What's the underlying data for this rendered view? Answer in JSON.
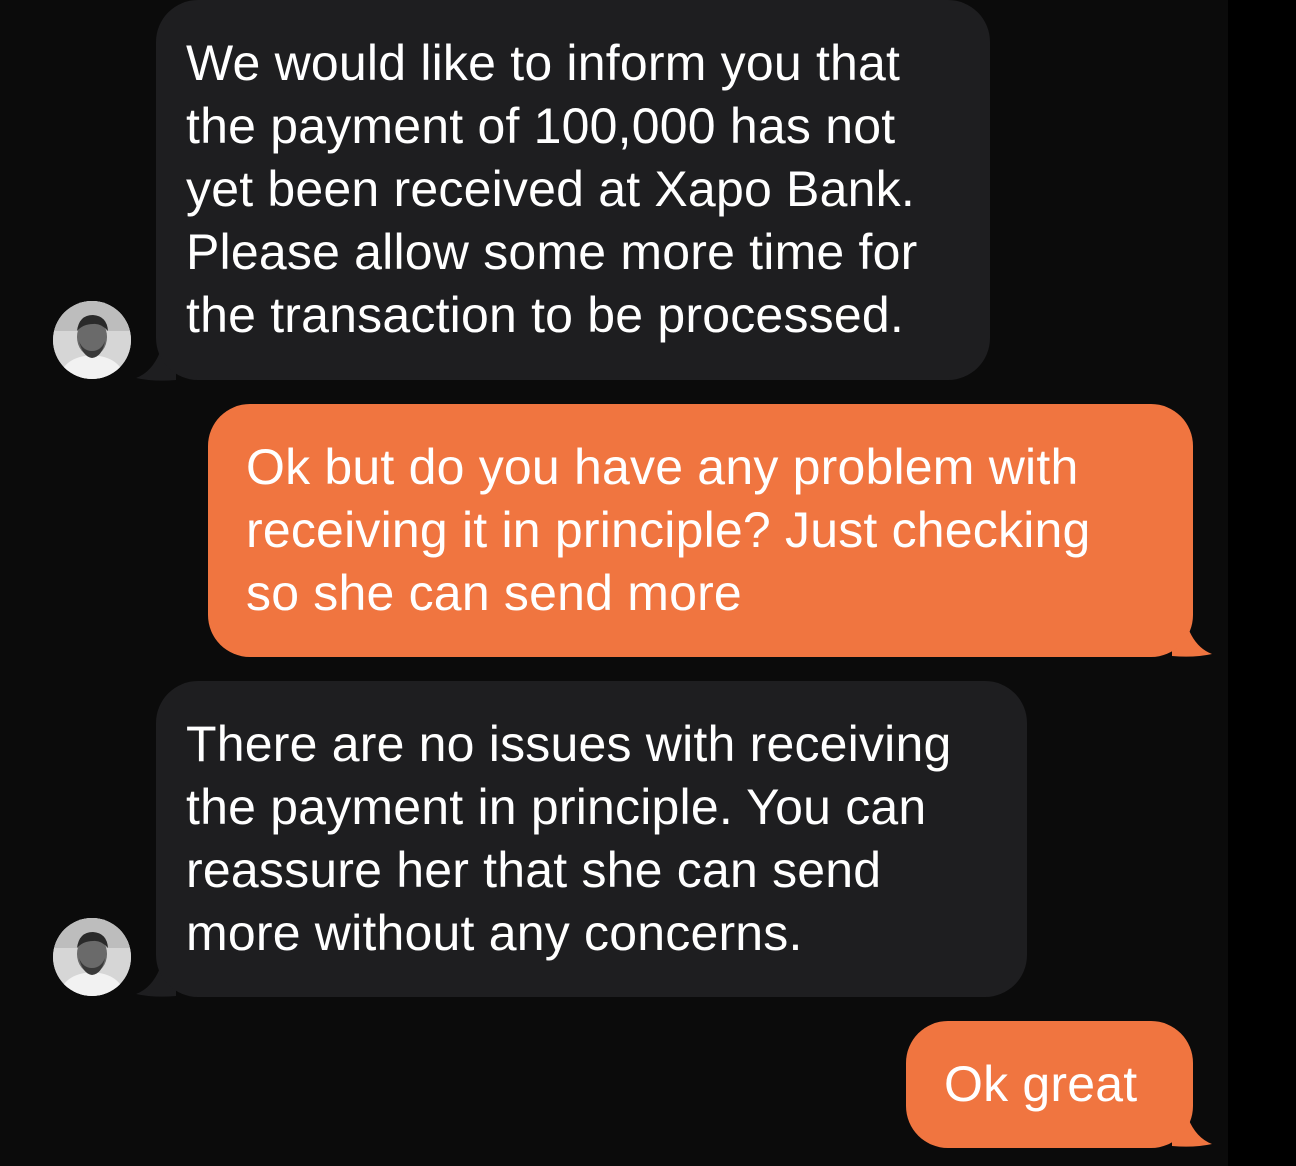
{
  "conversation": {
    "messages": [
      {
        "sender": "contact",
        "lines": [
          "We would like to inform you that",
          "the payment of 100,000 has not",
          "yet been received at Xapo Bank.",
          "Please allow some more time for",
          "the transaction to be processed."
        ]
      },
      {
        "sender": "me",
        "lines": [
          "Ok but do you have any problem with",
          "receiving it in principle? Just checking",
          "so she can send more"
        ]
      },
      {
        "sender": "contact",
        "lines": [
          "There are no issues with receiving",
          "the payment in principle. You can",
          "reassure her that she can send",
          "more without any concerns."
        ]
      },
      {
        "sender": "me",
        "lines": [
          "Ok great"
        ]
      }
    ]
  },
  "colors": {
    "background": "#0b0b0b",
    "incoming_bubble": "#1e1e20",
    "outgoing_bubble": "#f07540",
    "text": "#ffffff"
  },
  "icons": {
    "avatar": "contact-avatar-photo"
  }
}
